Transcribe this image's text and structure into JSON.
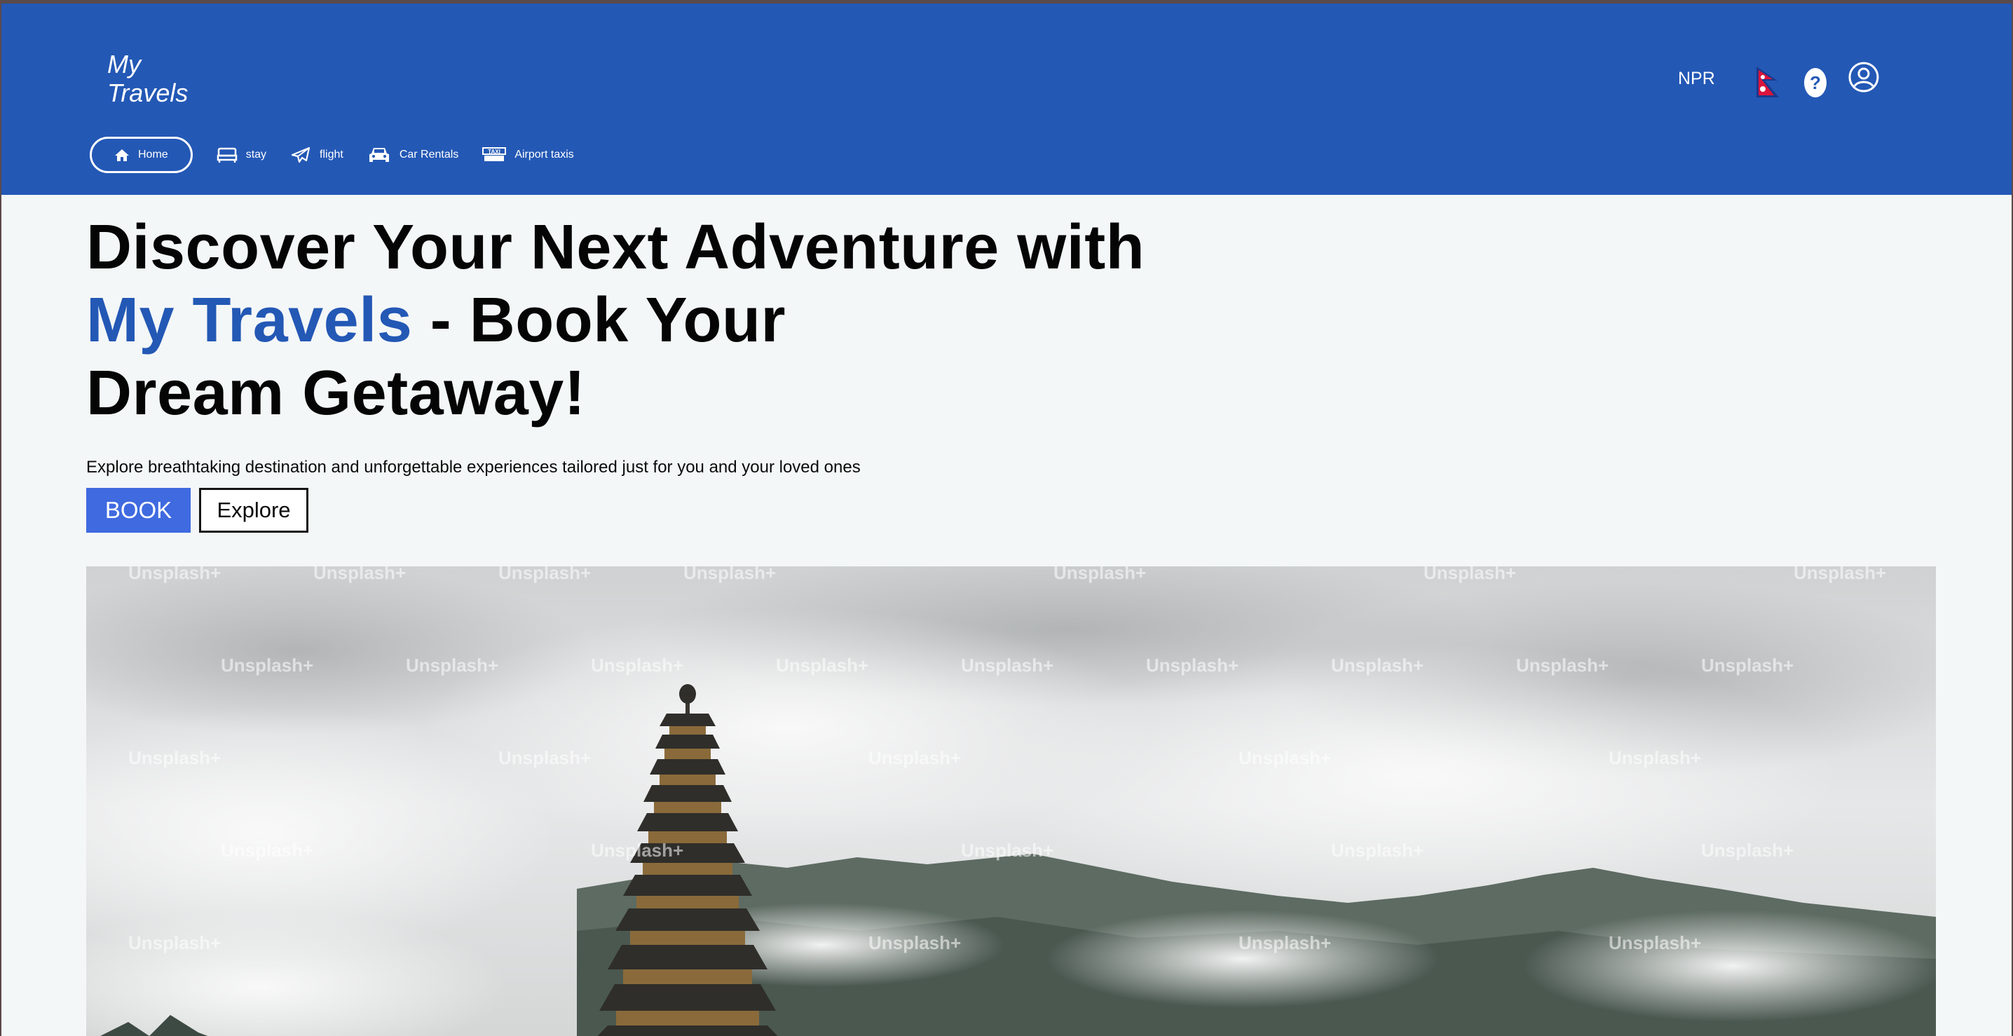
{
  "header": {
    "logo": "My\nTravels",
    "currency": "NPR",
    "flag_icon": "nepal-flag-icon",
    "help_label": "?",
    "account_icon": "user-circle-icon"
  },
  "nav": [
    {
      "label": "Home",
      "icon": "home-icon"
    },
    {
      "label": "stay",
      "icon": "bed-icon"
    },
    {
      "label": "flight",
      "icon": "plane-icon"
    },
    {
      "label": "Car Rentals",
      "icon": "car-icon"
    },
    {
      "label": "Airport taxis",
      "icon": "taxi-icon"
    }
  ],
  "hero": {
    "title_part1": "Discover Your Next Adventure with",
    "title_brand": "My Travels",
    "title_part2": " - Book Your",
    "title_part3": "Dream Getaway!",
    "subtitle": "Explore breathtaking destination and unforgettable experiences tailored just for you and your loved ones",
    "book_label": "BOOK",
    "explore_label": "Explore"
  },
  "image": {
    "watermark": "Unsplash+"
  },
  "colors": {
    "brand": "#2358b5",
    "book_button": "#3f6ae0",
    "background": "#f4f7f8"
  }
}
